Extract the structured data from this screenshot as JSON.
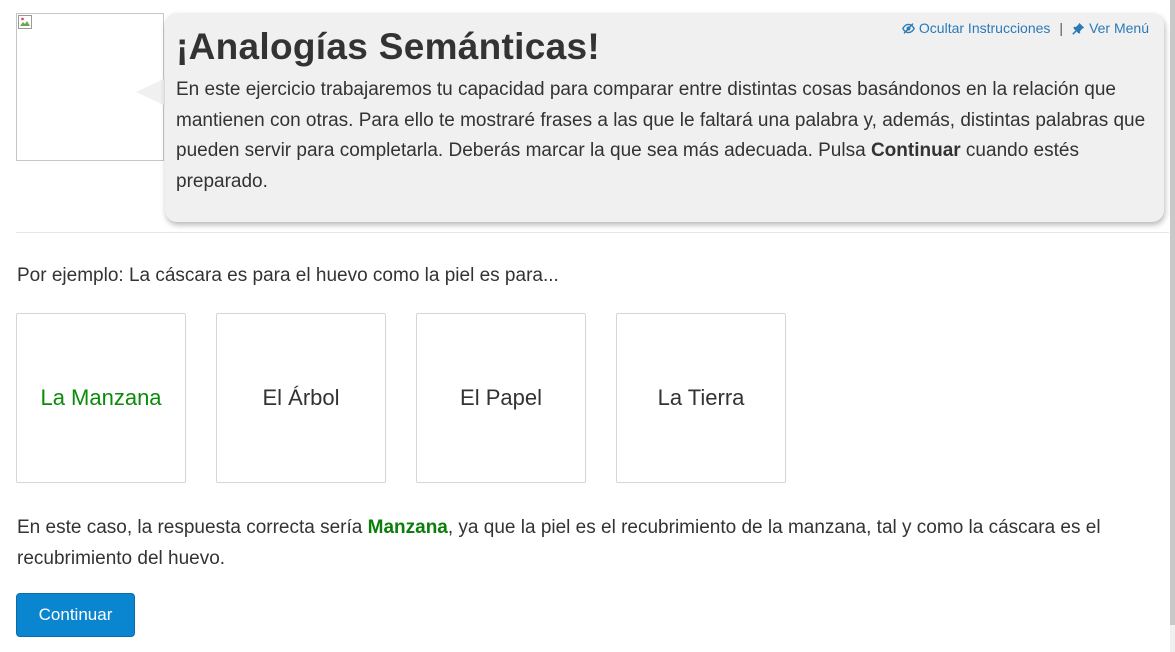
{
  "instructions": {
    "hide_link": "Ocultar Instrucciones",
    "separator": "|",
    "menu_link": "Ver Menú",
    "title": "¡Analogías Semánticas!",
    "text_before_bold": "En este ejercicio trabajaremos tu capacidad para comparar entre distintas cosas basándonos en la relación que mantienen con otras. Para ello te mostraré frases a las que le faltará una palabra y, además, distintas palabras que pueden servir para completarla. Deberás marcar la que sea más adecuada. Pulsa ",
    "text_bold": "Continuar",
    "text_after_bold": " cuando estés preparado."
  },
  "example": {
    "prompt": "Por ejemplo: La cáscara es para el huevo como la piel es para...",
    "options": [
      {
        "label": "La Manzana",
        "correct": true
      },
      {
        "label": "El Árbol",
        "correct": false
      },
      {
        "label": "El Papel",
        "correct": false
      },
      {
        "label": "La Tierra",
        "correct": false
      }
    ],
    "explanation_before": "En este caso, la respuesta correcta sería ",
    "explanation_answer": "Manzana",
    "explanation_after": ", ya que la piel es el recubrimiento de la manzana, tal y como la cáscara es el recubrimiento del huevo."
  },
  "actions": {
    "continue_label": "Continuar"
  },
  "icons": {
    "hide": "eye-slash-icon",
    "menu": "thumbtack-icon",
    "avatar": "broken-image-icon"
  },
  "colors": {
    "link": "#2a7ab8",
    "correct": "#0b8a0b",
    "button": "#0a86d0",
    "bubble": "#f0f0f0"
  }
}
